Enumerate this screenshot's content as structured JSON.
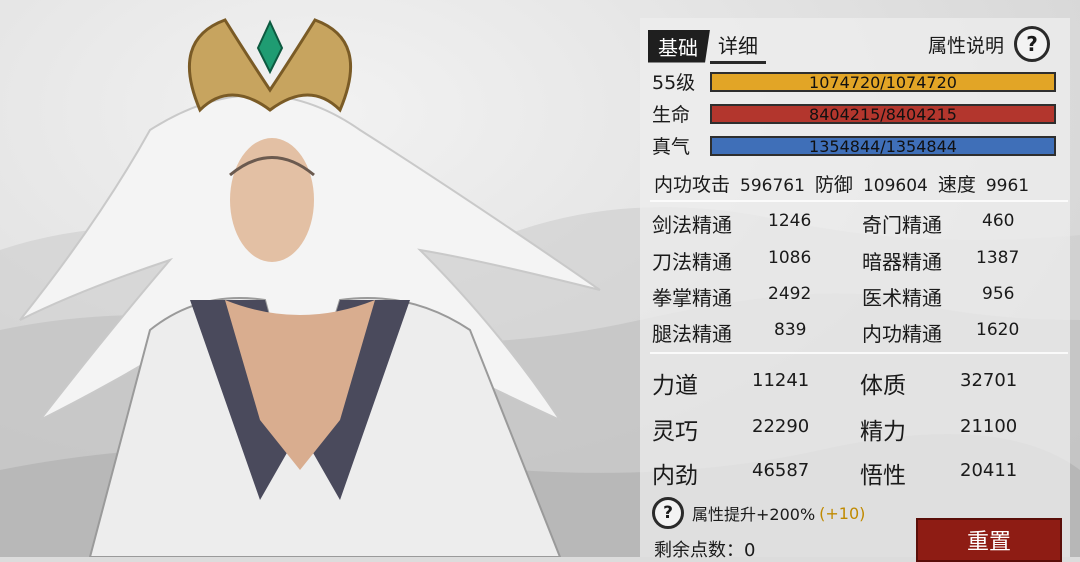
{
  "tabs": {
    "basic": "基础",
    "detail": "详细"
  },
  "attr_help": {
    "label": "属性说明",
    "icon": "?"
  },
  "bars": [
    {
      "label": "55级",
      "text": "1074720/1074720",
      "fill": 1.0,
      "color": "#e2a526"
    },
    {
      "label": "生命",
      "text": "8404215/8404215",
      "fill": 1.0,
      "color": "#b3362d"
    },
    {
      "label": "真气",
      "text": "1354844/1354844",
      "fill": 1.0,
      "color": "#3f6fb8"
    }
  ],
  "combat": {
    "attack_label": "内功攻击",
    "attack_value": "596761",
    "defense_label": "防御",
    "defense_value": "109604",
    "speed_label": "速度",
    "speed_value": "9961"
  },
  "mastery": [
    {
      "label": "剑法精通",
      "value": "1246"
    },
    {
      "label": "奇门精通",
      "value": "460"
    },
    {
      "label": "刀法精通",
      "value": "1086"
    },
    {
      "label": "暗器精通",
      "value": "1387"
    },
    {
      "label": "拳掌精通",
      "value": "2492"
    },
    {
      "label": "医术精通",
      "value": "956"
    },
    {
      "label": "腿法精通",
      "value": "839"
    },
    {
      "label": "内功精通",
      "value": "1620"
    }
  ],
  "attributes": [
    {
      "label": "力道",
      "value": "11241"
    },
    {
      "label": "体质",
      "value": "32701"
    },
    {
      "label": "灵巧",
      "value": "22290"
    },
    {
      "label": "精力",
      "value": "21100"
    },
    {
      "label": "内劲",
      "value": "46587"
    },
    {
      "label": "悟性",
      "value": "20411"
    }
  ],
  "boost": {
    "icon": "?",
    "text": "属性提升+200%",
    "extra": "(+10)"
  },
  "remaining": "剩余点数：0",
  "reset_label": "重置"
}
